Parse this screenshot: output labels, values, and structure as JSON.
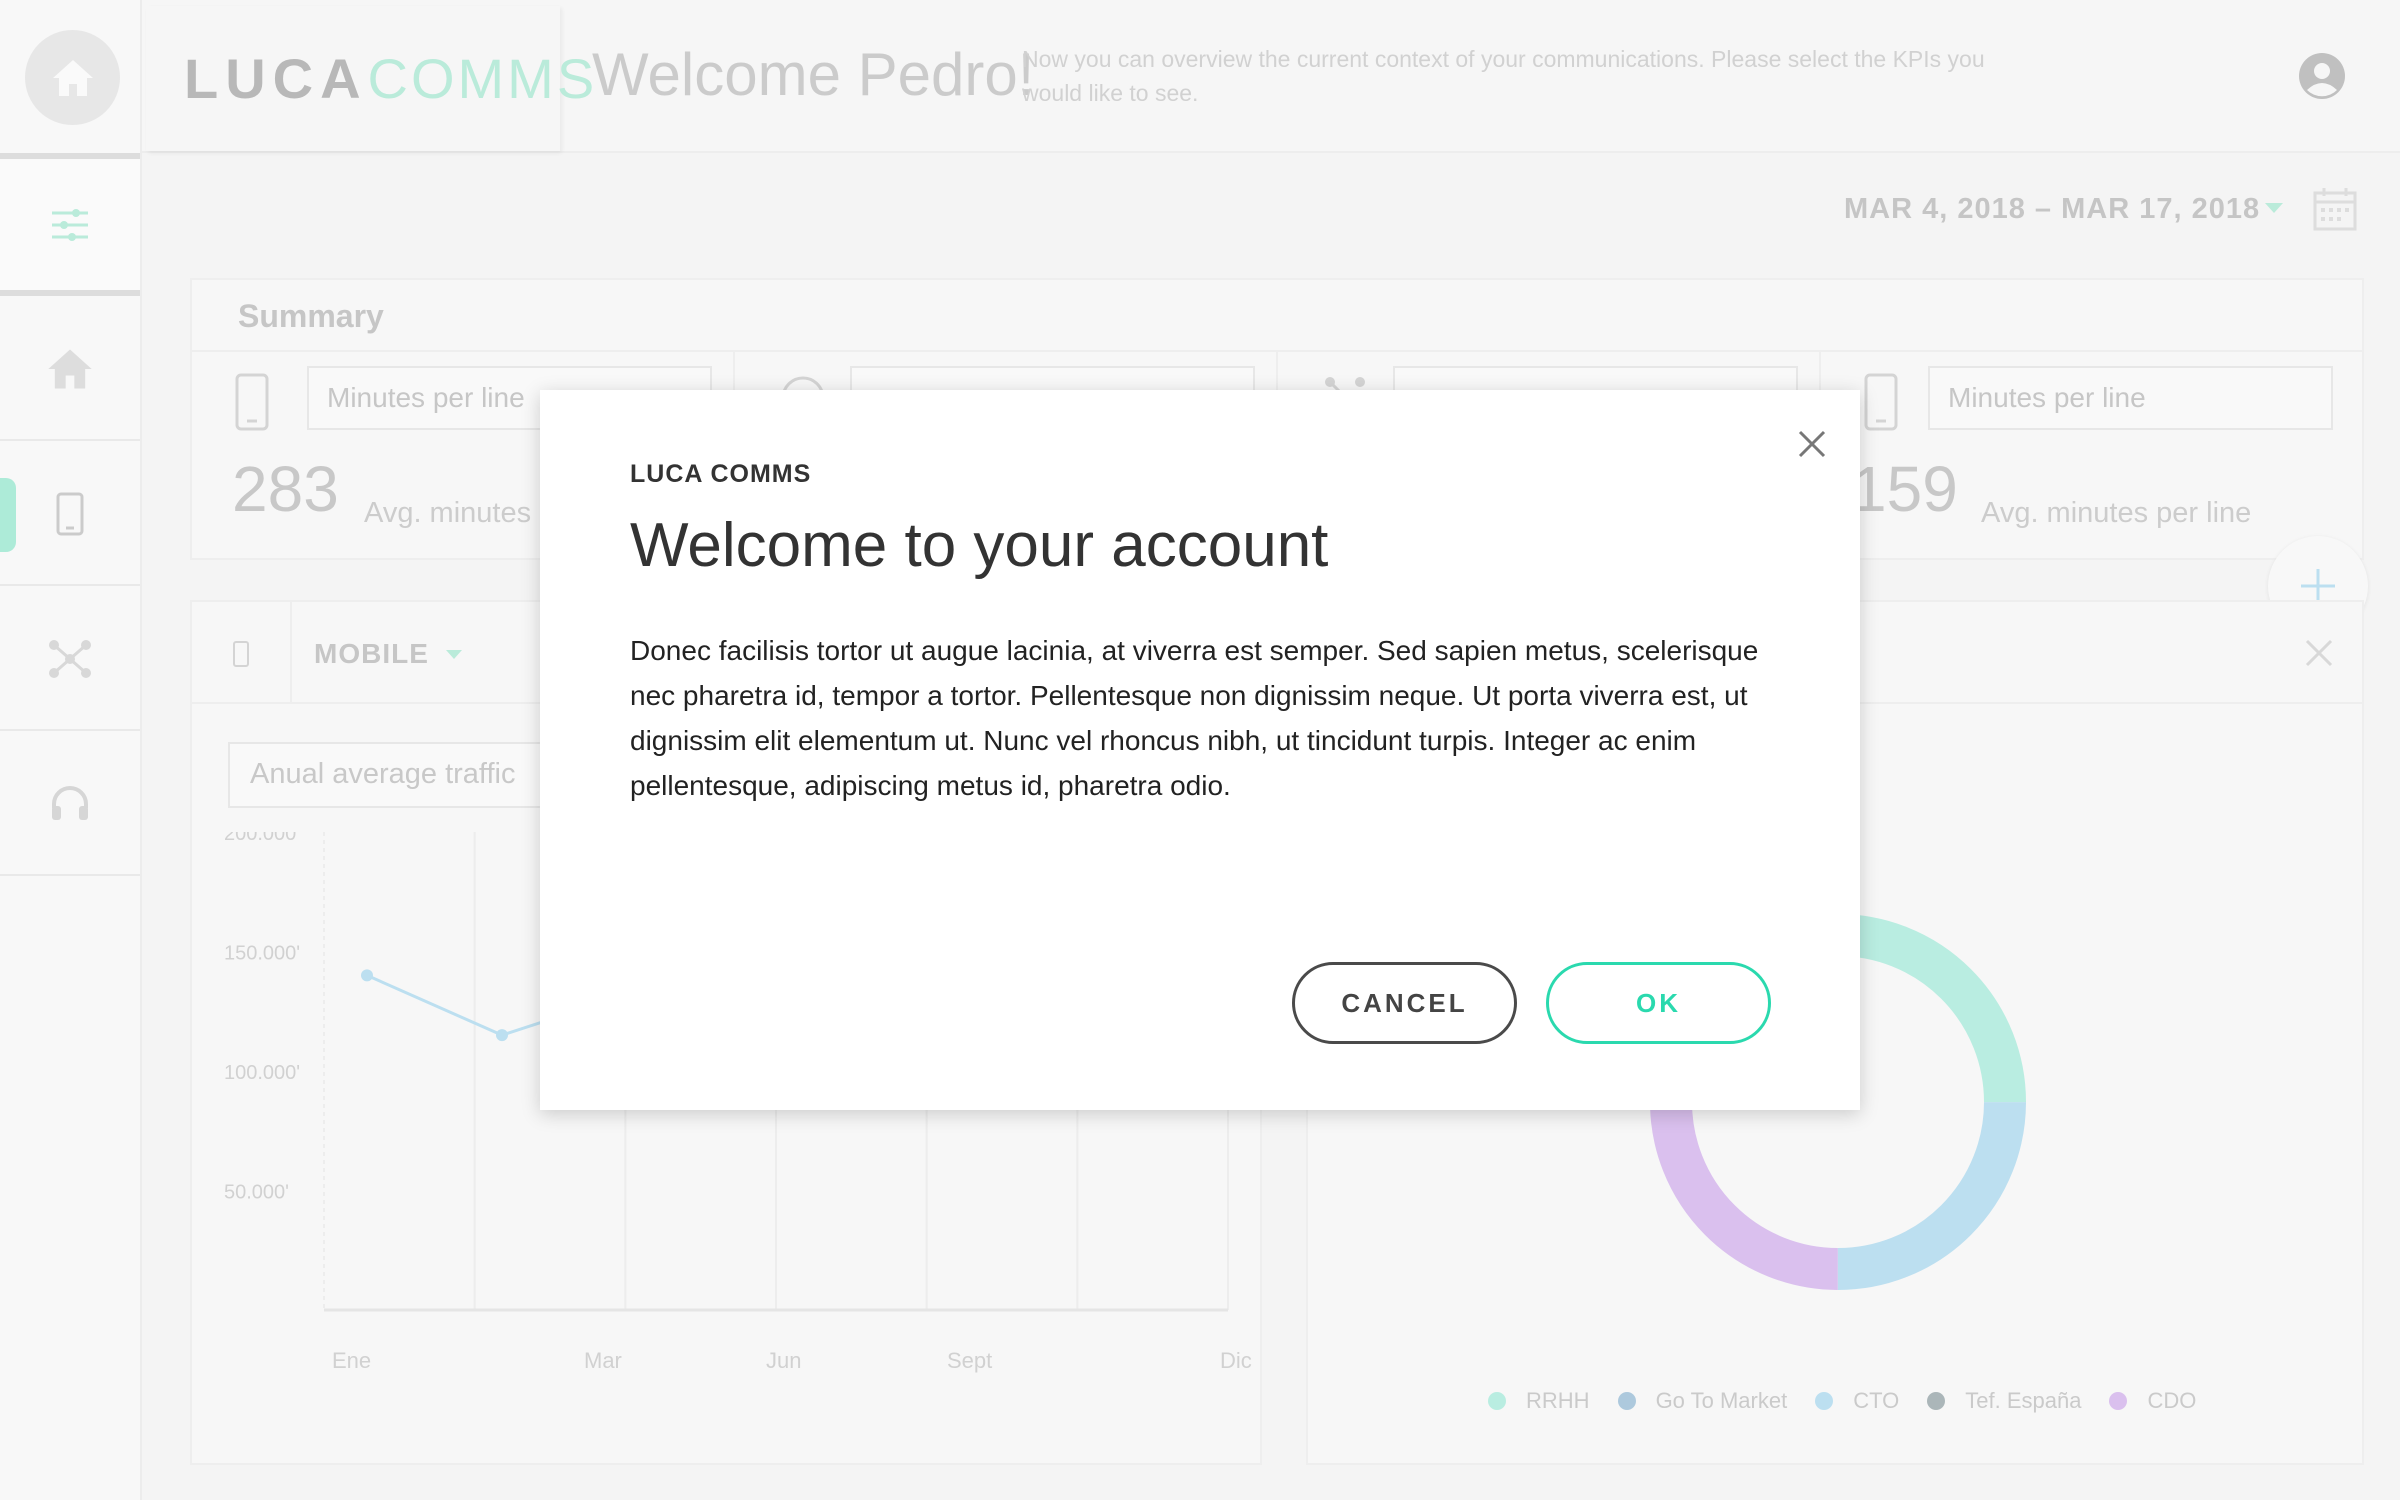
{
  "header": {
    "logo_luca": "LUCA",
    "logo_comms": "COMMS",
    "welcome": "Welcome Pedro!",
    "description": "Now you can overview the current context of your communications. Please select the KPIs you would like to see."
  },
  "toolbar": {
    "date_range": "MAR 4, 2018 – MAR 17, 2018"
  },
  "summary": {
    "title": "Summary",
    "kpis": [
      {
        "select": "Minutes per line",
        "value": "283",
        "sub": "Avg. minutes per line"
      },
      {
        "select": "",
        "value": "",
        "sub": ""
      },
      {
        "select": "",
        "value": "",
        "sub": ""
      },
      {
        "select": "Minutes per line",
        "value": "159",
        "sub": "Avg. minutes per line"
      }
    ]
  },
  "left_panel": {
    "tab_label": "MOBILE",
    "select": "Anual average traffic"
  },
  "chart_data": {
    "type": "line",
    "x": [
      "Ene",
      "Mar",
      "Jun",
      "Sept",
      "Dic"
    ],
    "yticks": [
      "200.000'",
      "150.000'",
      "100.000'",
      "50.000'"
    ],
    "ylim": [
      0,
      200000
    ],
    "series": [
      {
        "values": [
          140000,
          115000,
          130000
        ]
      }
    ]
  },
  "donut": {
    "segments": [
      {
        "label": "RRHH",
        "value": 25,
        "color": "#b6ede0"
      },
      {
        "label": "Go To Market",
        "value": 0,
        "color": "#a9c7dc"
      },
      {
        "label": "CTO",
        "value": 25,
        "color": "#b9def0"
      },
      {
        "label": "Tef. España",
        "value": 0,
        "color": "#a7b3b6"
      },
      {
        "label": "CDO",
        "value": 25,
        "color": "#d8bdee"
      }
    ]
  },
  "dialog": {
    "brand": "LUCA COMMS",
    "title": "Welcome to your account",
    "body": "Donec facilisis tortor ut augue lacinia, at viverra est semper. Sed sapien metus, scelerisque nec pharetra id, tempor a tortor. Pellentesque non dignissim neque. Ut porta viverra est, ut dignissim elit elementum ut. Nunc vel rhoncus nibh, ut tincidunt turpis. Integer ac enim pellentesque, adipiscing metus id, pharetra odio.",
    "cancel_label": "CANCEL",
    "ok_label": "OK"
  },
  "colors": {
    "accent": "#2ad9ae",
    "accent_light": "#b7ead9"
  }
}
